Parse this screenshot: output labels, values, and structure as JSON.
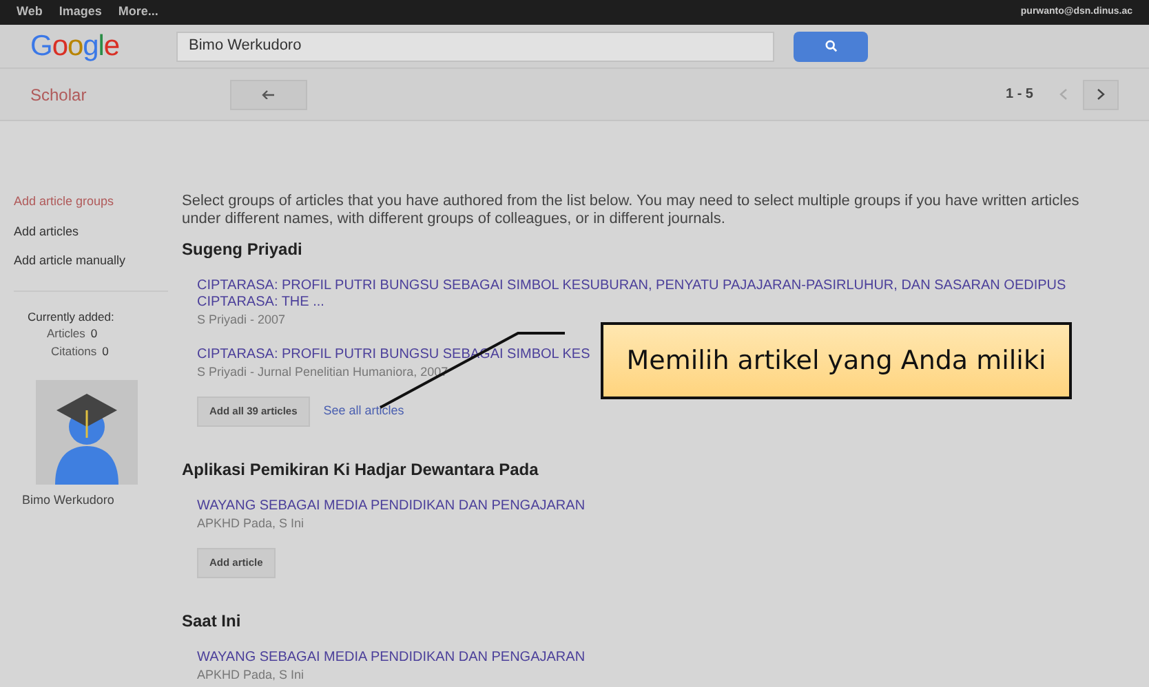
{
  "top_bar": {
    "links": [
      "Web",
      "Images",
      "More..."
    ],
    "account": "purwanto@dsn.dinus.ac"
  },
  "header": {
    "logo": "Google",
    "search": {
      "value": "Bimo Werkudoro"
    }
  },
  "toolbar": {
    "section": "Scholar",
    "range": "1 - 5"
  },
  "sidebar": {
    "items": [
      {
        "label": "Add article groups",
        "selected": true
      },
      {
        "label": "Add articles",
        "selected": false
      },
      {
        "label": "Add article manually",
        "selected": false
      }
    ],
    "added": {
      "heading": "Currently added:",
      "rows": [
        {
          "label": "Articles",
          "value": "0"
        },
        {
          "label": "Citations",
          "value": "0"
        }
      ]
    },
    "profile_name": "Bimo Werkudoro"
  },
  "intro": "Select groups of articles that you have authored from the list below. You may need to select multiple groups if you have written articles under different names, with different groups of colleagues, or in different journals.",
  "groups": [
    {
      "name": "Sugeng Priyadi",
      "articles": [
        {
          "title": "CIPTARASA: PROFIL PUTRI BUNGSU SEBAGAI SIMBOL KESUBURAN, PENYATU PAJAJARAN-PASIRLUHUR, DAN SASARAN OEDIPUS CIPTARASA: THE ...",
          "meta": "S Priyadi - 2007"
        },
        {
          "title": "CIPTARASA: PROFIL PUTRI BUNGSU SEBAGAI SIMBOL KES",
          "meta": "S Priyadi - Jurnal Penelitian Humaniora, 2007"
        }
      ],
      "button": "Add all 39 articles",
      "link": "See all articles"
    },
    {
      "name": "Aplikasi Pemikiran Ki Hadjar Dewantara Pada",
      "articles": [
        {
          "title": "WAYANG SEBAGAI MEDIA PENDIDIKAN DAN PENGAJARAN",
          "meta": "APKHD Pada, S Ini"
        }
      ],
      "button": "Add article"
    },
    {
      "name": "Saat Ini",
      "articles": [
        {
          "title": "WAYANG SEBAGAI MEDIA PENDIDIKAN DAN PENGAJARAN",
          "meta": "APKHD Pada, S Ini"
        }
      ]
    }
  ],
  "callout": "Memilih artikel yang Anda miliki"
}
